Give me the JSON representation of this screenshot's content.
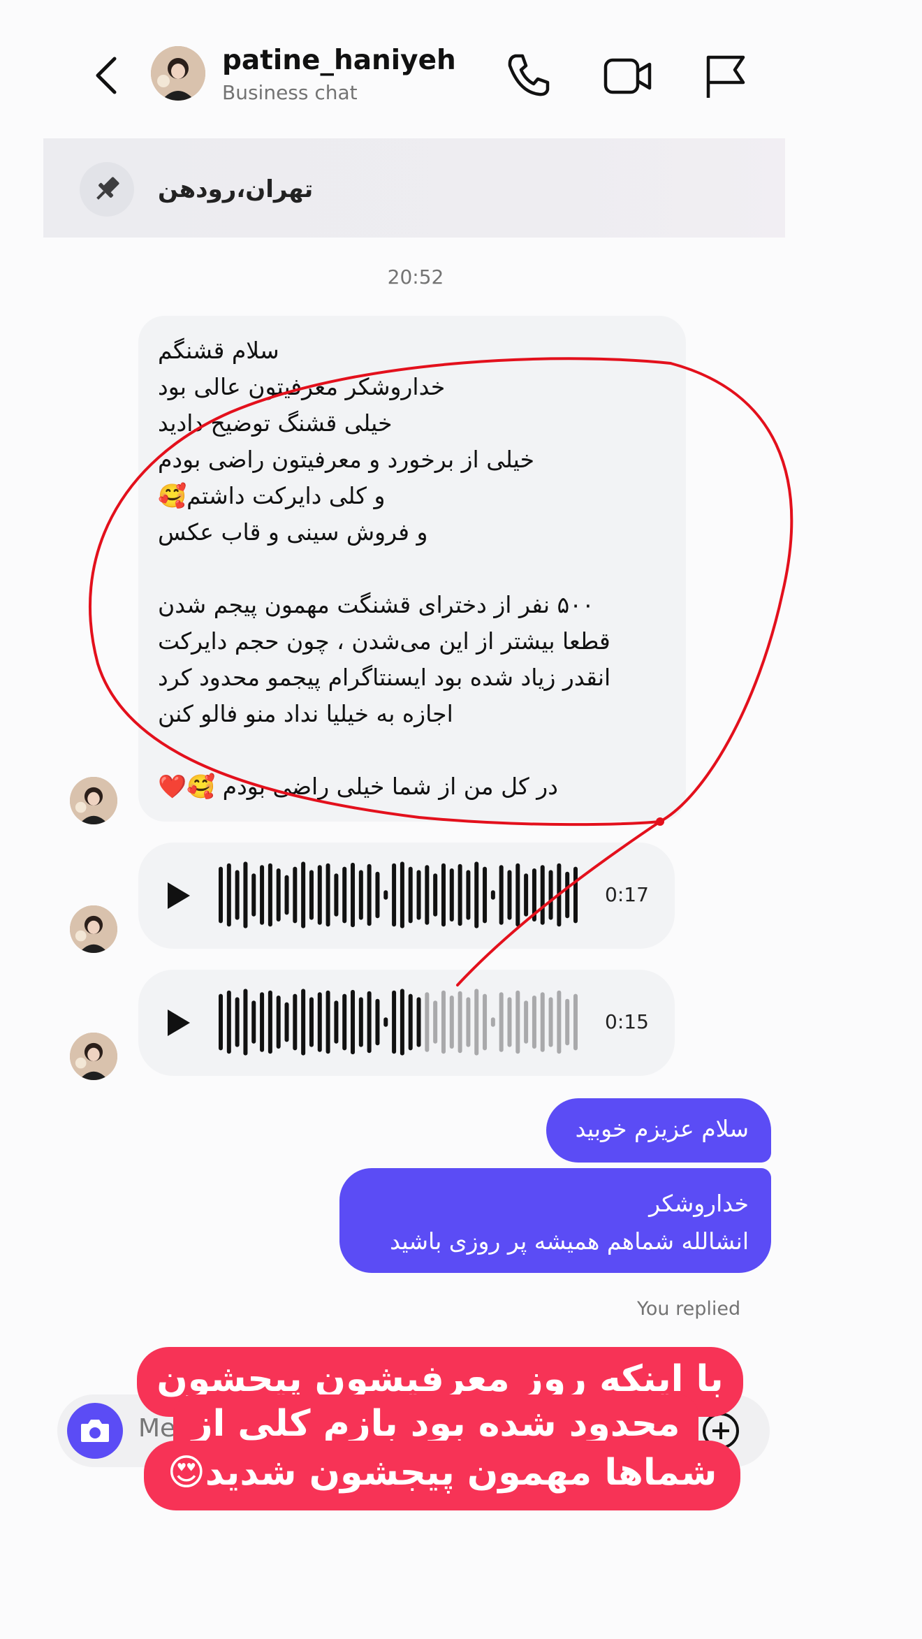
{
  "header": {
    "username": "patine_haniyeh",
    "subtitle": "Business chat",
    "icons": [
      "back-icon",
      "phone-icon",
      "video-icon",
      "flag-icon"
    ]
  },
  "pinned": {
    "text": "تهران،رودهن",
    "icon": "pin-icon"
  },
  "timestamp": "20:52",
  "received_message": {
    "lines": [
      "سلام قشنگم",
      "خداروشکر معرفیتون عالی بود",
      "خیلی قشنگ توضیح دادید",
      "خیلی از  برخورد و معرفیتون راضی بودم",
      "و کلی دایرکت داشتم🥰",
      "و فروش سینی و قاب عکس",
      "",
      "۵۰۰ نفر از دخترای قشنگت مهمون پیجم شدن",
      "قطعا بیشتر از این می‌شدن ، چون حجم دایرکت",
      "انقدر زیاد شده بود ایسنتاگرام پیجمو محدود کرد",
      "اجازه به خیلیا نداد منو فالو کنن",
      "",
      "در کل من از شما خیلی راضی بودم 🥰❤️"
    ]
  },
  "voice_messages": [
    {
      "duration": "0:17",
      "played_fraction": 1.0
    },
    {
      "duration": "0:15",
      "played_fraction": 0.55
    }
  ],
  "sent_messages": [
    {
      "text": "سلام عزیزم خوبید"
    },
    {
      "lines": [
        "خداروشکر",
        "انشالله شماهم همیشه پر روزی  باشید"
      ]
    }
  ],
  "replied_label": "You replied",
  "composer": {
    "placeholder": "Me"
  },
  "sticker": {
    "lines": [
      "با اینکه روز معرفیشون پیجشون",
      "محدود شده بود بازم کلی از",
      "شماها مهمون پیجشون شدید😍"
    ]
  },
  "colors": {
    "accent": "#5b4cf5",
    "sticker": "#f73356",
    "annotation": "#e3101c",
    "bubble_in": "#f2f3f5"
  }
}
